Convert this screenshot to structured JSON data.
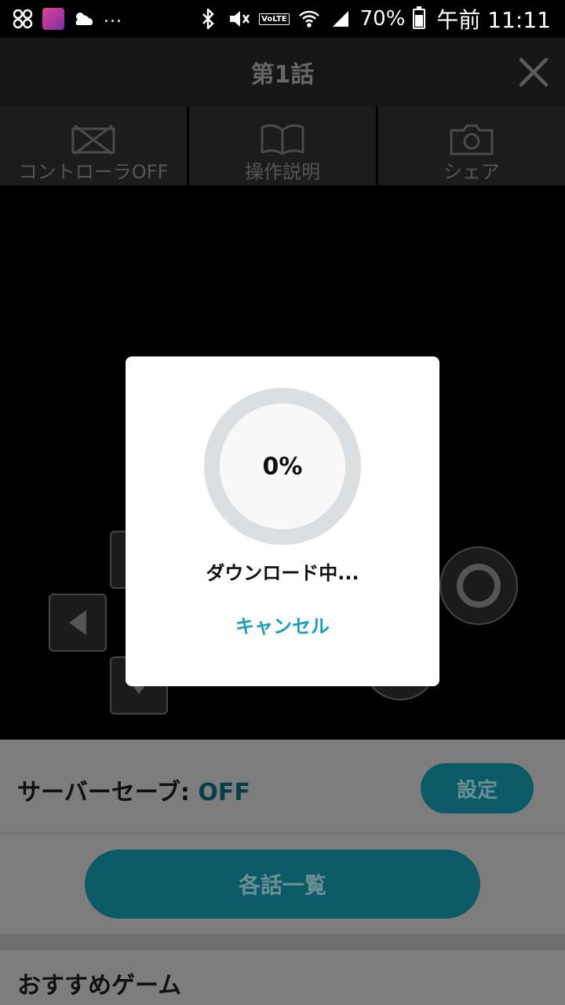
{
  "status_bar": {
    "battery": "70%",
    "time": "午前 11:11",
    "more": "...",
    "volte": "VoLTE"
  },
  "header": {
    "title": "第1話"
  },
  "toolbar": {
    "controller_label": "コントローラOFF",
    "manual_label": "操作説明",
    "share_label": "シェア"
  },
  "dialog": {
    "progress_percent": 0,
    "progress_text": "0%",
    "status": "ダウンロード中...",
    "cancel_label": "キャンセル"
  },
  "save": {
    "label": "サーバーセーブ: ",
    "value": "OFF",
    "settings_label": "設定"
  },
  "episodes_label": "各話一覧",
  "recommend_title": "おすすめゲーム",
  "colors": {
    "accent": "#1a9fbf",
    "teal_button": "#0b5a66",
    "ring_track": "#dcdfe2"
  },
  "icons": [
    "pinwheel-icon",
    "app-icon",
    "weather-icon",
    "bluetooth-icon",
    "mute-icon",
    "volte-icon",
    "wifi-icon",
    "signal-icon",
    "battery-icon",
    "close-icon",
    "controller-off-icon",
    "book-icon",
    "camera-icon"
  ]
}
